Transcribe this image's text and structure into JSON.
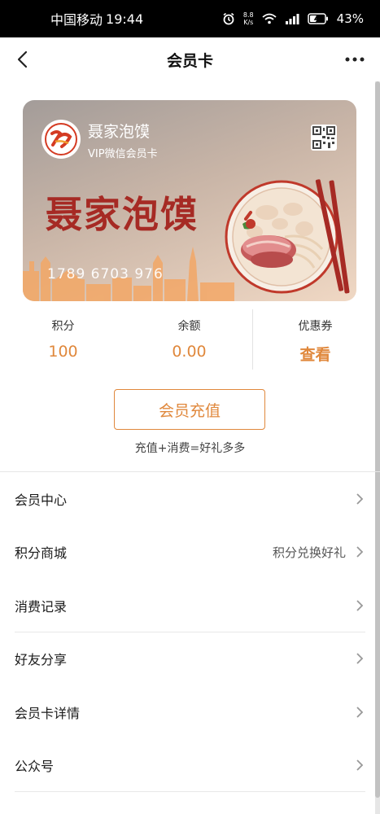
{
  "status_bar": {
    "carrier": "中国移动",
    "time": "19:44",
    "net_speed_top": "8.8",
    "net_speed_unit": "K/s",
    "battery": "43%"
  },
  "nav": {
    "title": "会员卡"
  },
  "card": {
    "shop_name": "聂家泡馍",
    "card_type": "VIP微信会员卡",
    "big_title": "聂家泡馍",
    "card_number": "1789 6703 976"
  },
  "stats": [
    {
      "label": "积分",
      "value": "100"
    },
    {
      "label": "余额",
      "value": "0.00"
    },
    {
      "label": "优惠券",
      "value": "查看"
    }
  ],
  "recharge": {
    "button_label": "会员充值",
    "tip": "充值+消费=好礼多多"
  },
  "menu": [
    {
      "label": "会员中心",
      "extra": ""
    },
    {
      "label": "积分商城",
      "extra": "积分兑换好礼"
    },
    {
      "label": "消费记录",
      "extra": ""
    },
    {
      "label": "好友分享",
      "extra": ""
    },
    {
      "label": "会员卡详情",
      "extra": ""
    },
    {
      "label": "公众号",
      "extra": ""
    }
  ],
  "colors": {
    "accent": "#e0883c",
    "card_title": "#a62a24"
  }
}
